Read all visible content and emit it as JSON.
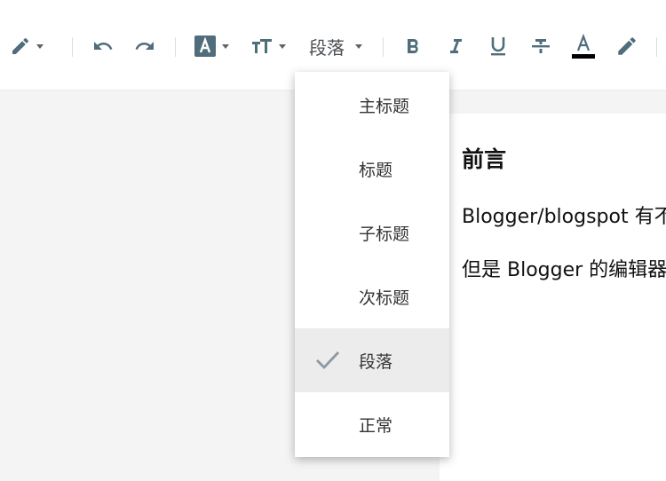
{
  "toolbar": {
    "tools": [
      {
        "name": "pen-icon",
        "has_menu": true
      },
      {
        "name": "undo-icon",
        "has_menu": false
      },
      {
        "name": "redo-icon",
        "has_menu": false
      },
      {
        "name": "text-style-icon",
        "has_menu": true
      },
      {
        "name": "font-size-icon",
        "has_menu": true
      },
      {
        "name": "bold-icon",
        "has_menu": false
      },
      {
        "name": "italic-icon",
        "has_menu": false
      },
      {
        "name": "underline-icon",
        "has_menu": false
      },
      {
        "name": "strikethrough-icon",
        "has_menu": false
      },
      {
        "name": "text-color-icon",
        "has_menu": false
      },
      {
        "name": "highlight-icon",
        "has_menu": false
      }
    ],
    "paragraph_select": "段落",
    "icon_color": "#4f6d7a",
    "text_color_bar": "#000000"
  },
  "format_menu": {
    "items": [
      {
        "label": "主标题",
        "selected": false
      },
      {
        "label": "标题",
        "selected": false
      },
      {
        "label": "子标题",
        "selected": false
      },
      {
        "label": "次标题",
        "selected": false
      },
      {
        "label": "段落",
        "selected": true
      },
      {
        "label": "正常",
        "selected": false
      }
    ],
    "check_icon": "check-icon",
    "selected_background": "#ececec"
  },
  "document": {
    "heading": "前言",
    "paragraphs": [
      "Blogger/blogspot 有不",
      "但是 Blogger 的编辑器"
    ]
  }
}
